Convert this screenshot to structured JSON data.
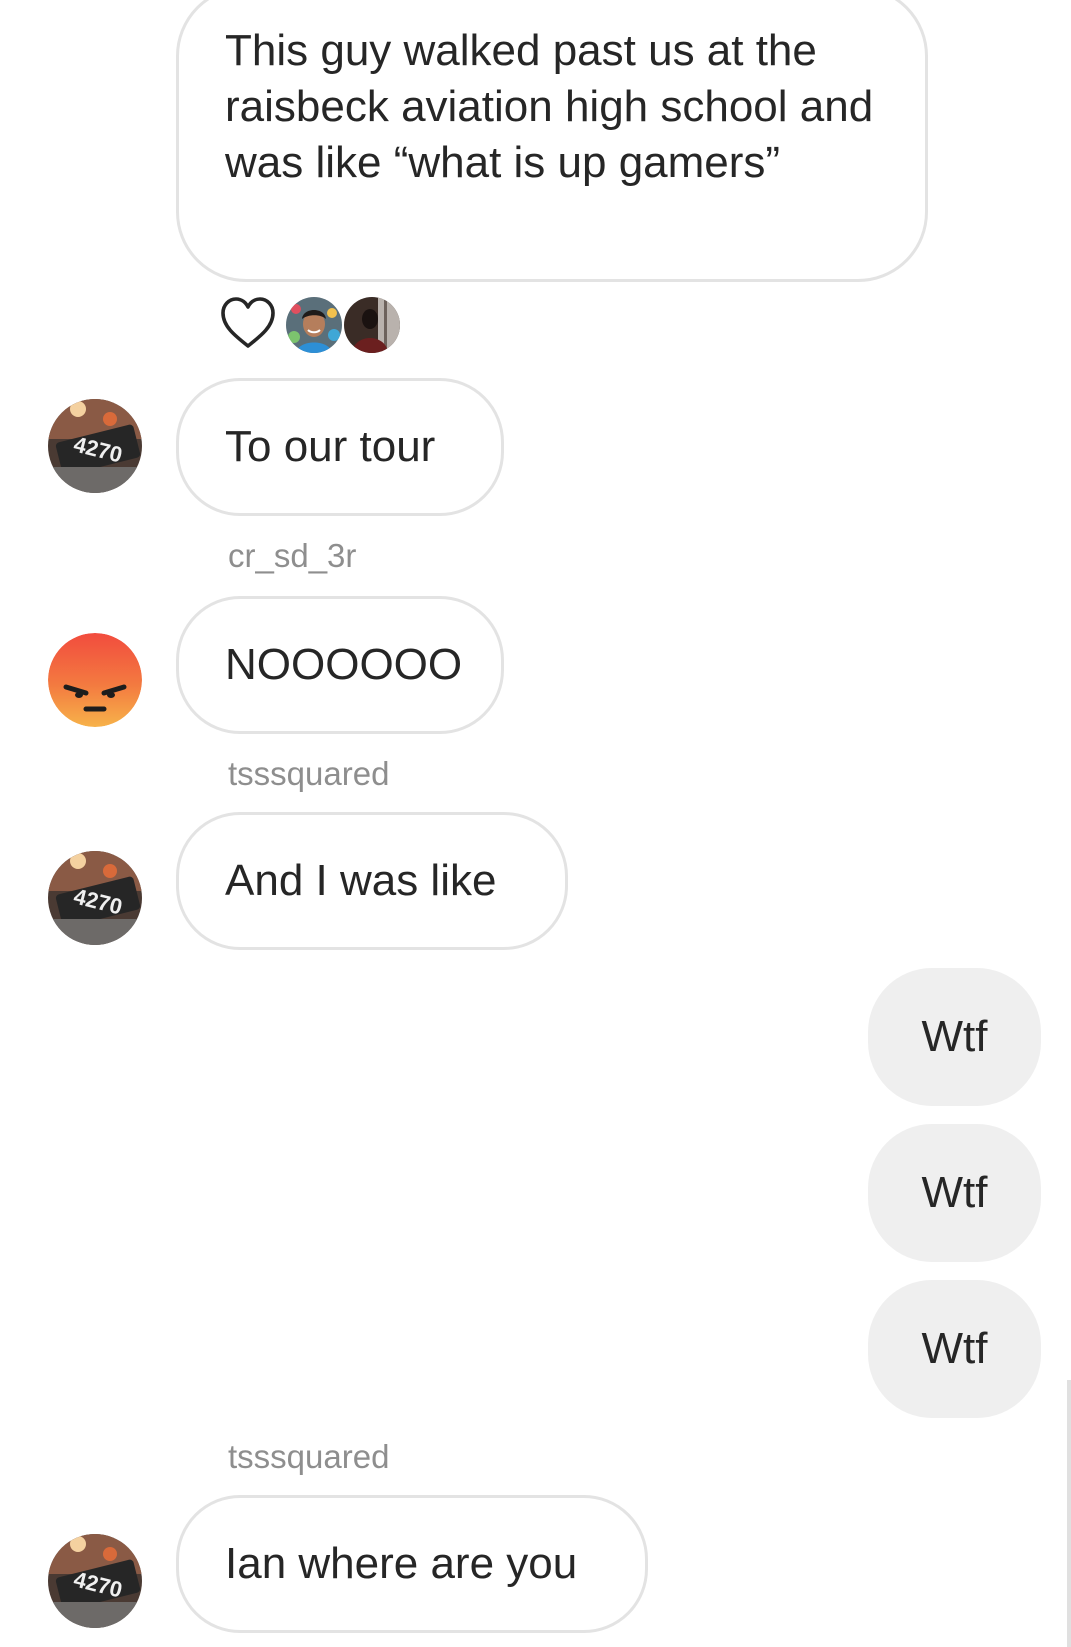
{
  "colors": {
    "bubble_border": "#e3e3e3",
    "my_bubble_bg": "#efefef",
    "text": "#262626",
    "username": "#8e8e8e",
    "angry_top": "#f24c3e",
    "angry_bottom": "#f7b24a"
  },
  "messages": [
    {
      "sender": "other",
      "text": "This guy walked past us at the raisbeck aviation high school and was like “what is up gamers”",
      "reactions": [
        "heart-icon",
        "reactor-avatar-1",
        "reactor-avatar-2"
      ]
    },
    {
      "sender": "other",
      "text": "To our tour",
      "avatar": "4270-avatar"
    },
    {
      "sender": "other",
      "username": "cr_sd_3r",
      "text": "NOOOOOO",
      "avatar": "angry-face-avatar"
    },
    {
      "sender": "other",
      "username": "tsssquared",
      "text": "And I was like",
      "avatar": "4270-avatar"
    },
    {
      "sender": "me",
      "text": "Wtf"
    },
    {
      "sender": "me",
      "text": "Wtf"
    },
    {
      "sender": "me",
      "text": "Wtf"
    },
    {
      "sender": "other",
      "username": "tsssquared",
      "text": "Ian where are you",
      "avatar": "4270-avatar"
    }
  ]
}
